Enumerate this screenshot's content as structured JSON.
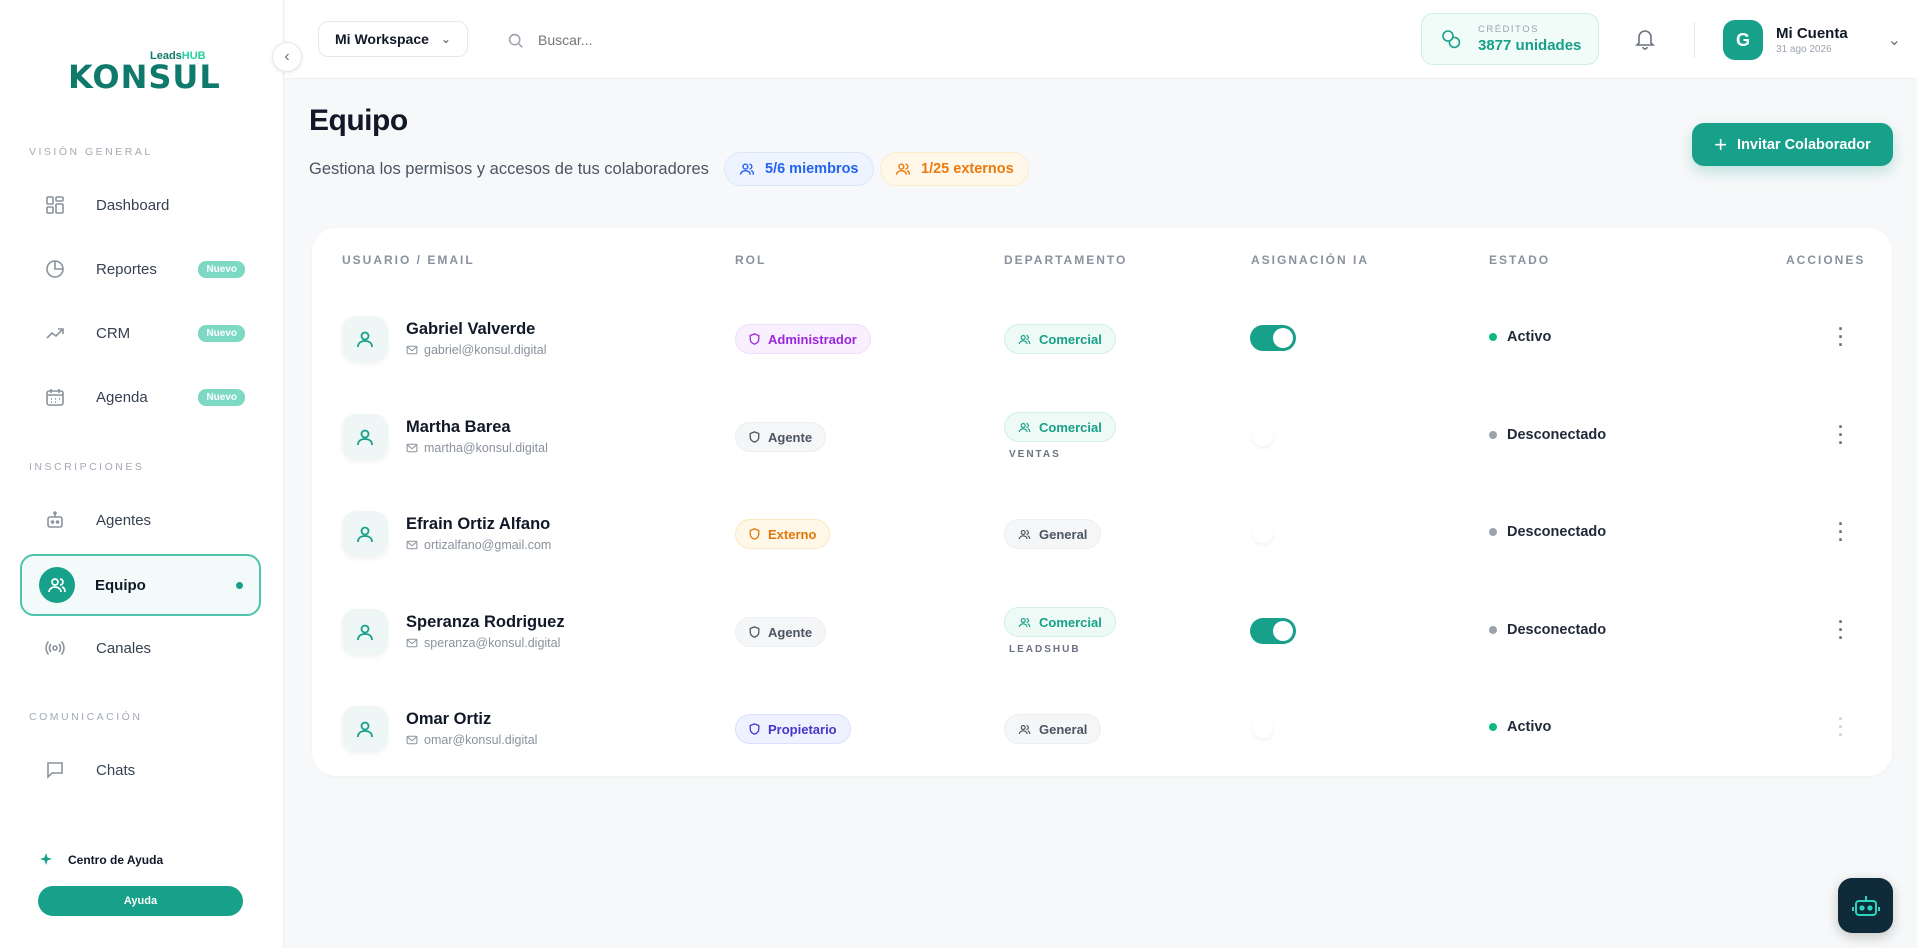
{
  "brand": {
    "logo_main": "KONSUL",
    "logo_sub_a": "Leads",
    "logo_sub_b": "HUB"
  },
  "sidebar": {
    "section_general": "VISIÓN GENERAL",
    "section_inscripciones": "INSCRIPCIONES",
    "section_comunicacion": "COMUNICACIÓN",
    "items": [
      {
        "label": "Dashboard",
        "icon": "grid-icon"
      },
      {
        "label": "Reportes",
        "icon": "pie-chart-icon",
        "badge": "Nuevo"
      },
      {
        "label": "CRM",
        "icon": "trending-up-icon",
        "badge": "Nuevo"
      },
      {
        "label": "Agenda",
        "icon": "calendar-icon",
        "badge": "Nuevo"
      },
      {
        "label": "Agentes",
        "icon": "bot-icon"
      },
      {
        "label": "Equipo",
        "icon": "users-icon",
        "active": true
      },
      {
        "label": "Canales",
        "icon": "broadcast-icon"
      },
      {
        "label": "Chats",
        "icon": "chat-icon"
      }
    ],
    "help_label": "Centro de Ayuda",
    "help_button": "Ayuda"
  },
  "header": {
    "workspace": "Mi Workspace",
    "search_placeholder": "Buscar...",
    "credits_label": "CRÉDITOS",
    "credits_value": "3877 unidades",
    "account_name": "Mi Cuenta",
    "account_date": "31 ago 2026",
    "avatar_letter": "G"
  },
  "page": {
    "title": "Equipo",
    "subtitle": "Gestiona los permisos y accesos de tus colaboradores",
    "members_pill": "5/6 miembros",
    "externals_pill": "1/25 externos",
    "invite_button": "Invitar Colaborador"
  },
  "table": {
    "headers": {
      "user": "USUARIO / EMAIL",
      "rol": "ROL",
      "dept": "DEPARTAMENTO",
      "ia": "ASIGNACIÓN IA",
      "estado": "ESTADO",
      "acciones": "ACCIONES"
    },
    "rows": [
      {
        "name": "Gabriel Valverde",
        "email": "gabriel@konsul.digital",
        "rol": "Administrador",
        "dept": "Comercial",
        "subdept": "",
        "ia": true,
        "estado": "Activo"
      },
      {
        "name": "Martha Barea",
        "email": "martha@konsul.digital",
        "rol": "Agente",
        "dept": "Comercial",
        "subdept": "VENTAS",
        "ia": false,
        "estado": "Desconectado"
      },
      {
        "name": "Efrain Ortiz Alfano",
        "email": "ortizalfano@gmail.com",
        "rol": "Externo",
        "dept": "General",
        "subdept": "",
        "ia": false,
        "estado": "Desconectado"
      },
      {
        "name": "Speranza Rodriguez",
        "email": "speranza@konsul.digital",
        "rol": "Agente",
        "dept": "Comercial",
        "subdept": "LEADSHUB",
        "ia": true,
        "estado": "Desconectado"
      },
      {
        "name": "Omar Ortiz",
        "email": "omar@konsul.digital",
        "rol": "Propietario",
        "dept": "General",
        "subdept": "",
        "ia": false,
        "estado": "Activo"
      }
    ]
  },
  "colors": {
    "accent": "#17a08a",
    "active": "#10b981",
    "inactive": "#9ca3af"
  }
}
